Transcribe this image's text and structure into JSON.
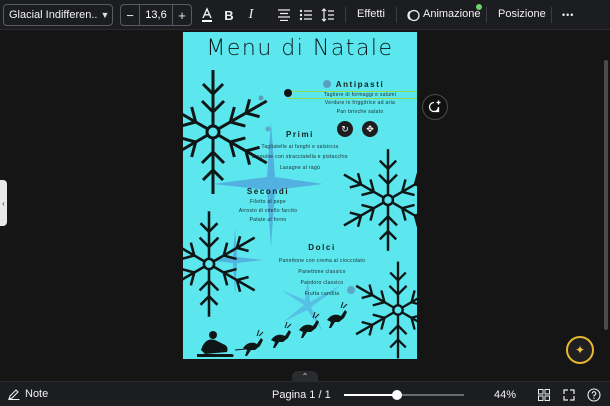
{
  "toolbar": {
    "font_name": "Glacial Indifferen...",
    "font_size": "13,6",
    "minus": "−",
    "plus": "+",
    "effects": "Effetti",
    "animation": "Animazione",
    "position": "Posizione",
    "more": "•••"
  },
  "design": {
    "title": "Menu di Natale",
    "sections": [
      {
        "title": "Antipasti",
        "items": [
          "Tagliere di formaggi e salumi",
          "Verdure in friggitrice ad aria",
          "Pan brioche salato"
        ]
      },
      {
        "title": "Primi",
        "items": [
          "Tagliatelle ai funghi e salsiccia",
          "Linguine con stracciatella e pistacchio",
          "Lasagne al ragù"
        ]
      },
      {
        "title": "Secondi",
        "items": [
          "Filetto al pepe",
          "Arrosto di vitello farcito",
          "Patate al forno"
        ]
      },
      {
        "title": "Dolci",
        "items": [
          "Panettone con crema al cioccolato",
          "Panettone classico",
          "Pandoro classico",
          "Frutta candita"
        ]
      }
    ],
    "background_color": "#5ce6ee"
  },
  "bottombar": {
    "notes": "Note",
    "page": "Pagina 1 / 1",
    "zoom": "44%",
    "zoom_fraction": 0.44
  },
  "colors": {
    "selection": "#8ddc4c",
    "accent_ring": "#e8b82d"
  }
}
